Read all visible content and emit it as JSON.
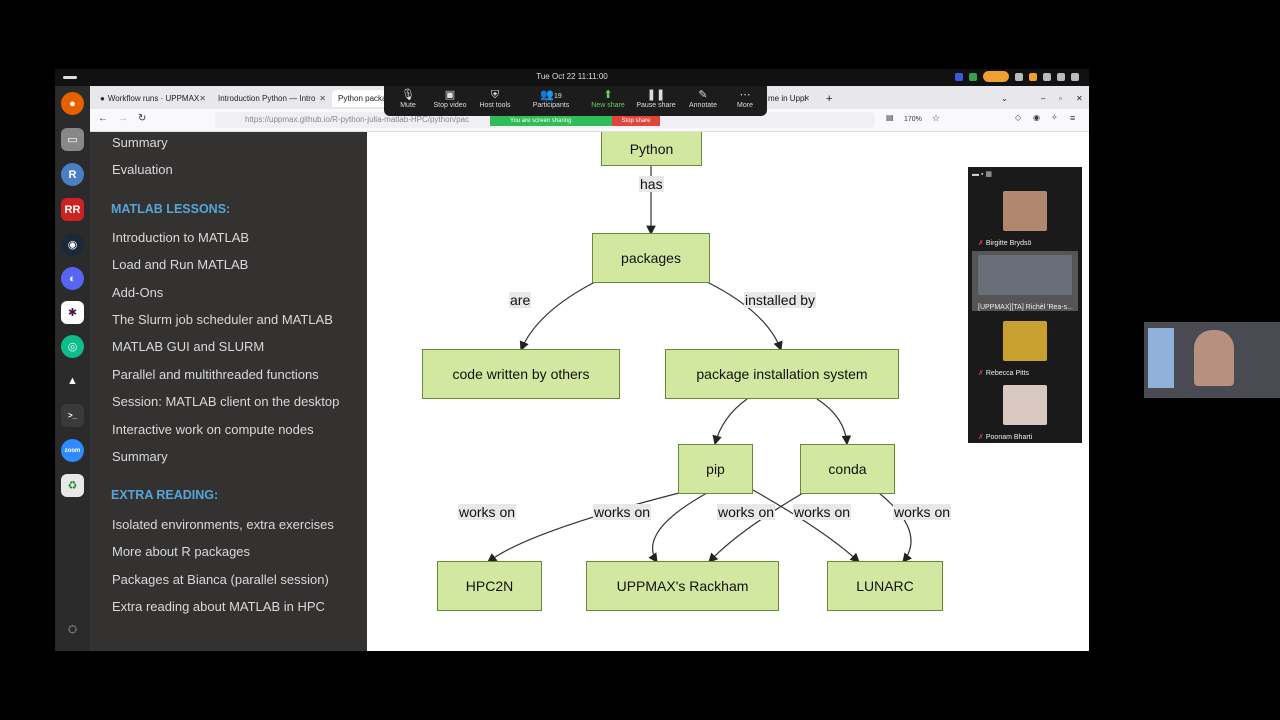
{
  "os": {
    "clock": "Tue Oct 22  11:11:00"
  },
  "browser": {
    "tabs": [
      {
        "label": "Workflow runs · UPPMAX"
      },
      {
        "label": "Introduction Python — Intro"
      },
      {
        "label": "Python packa"
      },
      {
        "label": "me in Uppl"
      }
    ],
    "url": "https://uppmax.github.io/R-python-julia-matlab-HPC/python/pac",
    "zoom": "170%"
  },
  "zoom_meeting": {
    "controls": [
      {
        "label": "Mute",
        "icon": "microphone-icon"
      },
      {
        "label": "Stop video",
        "icon": "video-icon"
      },
      {
        "label": "Host tools",
        "icon": "shield-icon"
      },
      {
        "label": "Participants",
        "icon": "participants-icon",
        "count": "19"
      },
      {
        "label": "New share",
        "icon": "share-icon"
      },
      {
        "label": "Pause share",
        "icon": "pause-icon"
      },
      {
        "label": "Annotate",
        "icon": "pencil-icon"
      },
      {
        "label": "More",
        "icon": "more-icon"
      }
    ],
    "share_banner": "You are screen sharing",
    "stop_share": "Stop share",
    "participants": [
      {
        "name": "Birgitte Brydsö"
      },
      {
        "name": "[UPPMAX][TA] Richèl 'Rea-s..."
      },
      {
        "name": "Rebecca Pitts"
      },
      {
        "name": "Poonam Bharti"
      }
    ]
  },
  "sidebar": {
    "items_top": [
      "Summary",
      "Evaluation"
    ],
    "matlab_heading": "MATLAB LESSONS:",
    "matlab_items": [
      "Introduction to MATLAB",
      "Load and Run MATLAB",
      "Add-Ons",
      "The Slurm job scheduler and MATLAB",
      "MATLAB GUI and SLURM",
      "Parallel and multithreaded functions",
      "Session: MATLAB client on the desktop",
      "Interactive work on compute nodes",
      "Summary"
    ],
    "extra_heading": "EXTRA READING:",
    "extra_items": [
      "Isolated environments, extra exercises",
      "More about R packages",
      "Packages at Bianca (parallel session)",
      "Extra reading about MATLAB in HPC"
    ]
  },
  "diagram": {
    "nodes": {
      "python": "Python",
      "packages": "packages",
      "code_by_others": "code written by others",
      "pkg_install_system": "package installation system",
      "pip": "pip",
      "conda": "conda",
      "hpc2n": "HPC2N",
      "rackham": "UPPMAX's Rackham",
      "lunarc": "LUNARC"
    },
    "edges": {
      "has": "has",
      "are": "are",
      "installed_by": "installed by",
      "works_on_1": "works on",
      "works_on_2": "works on",
      "works_on_3": "works on",
      "works_on_4": "works on",
      "works_on_5": "works on"
    }
  }
}
